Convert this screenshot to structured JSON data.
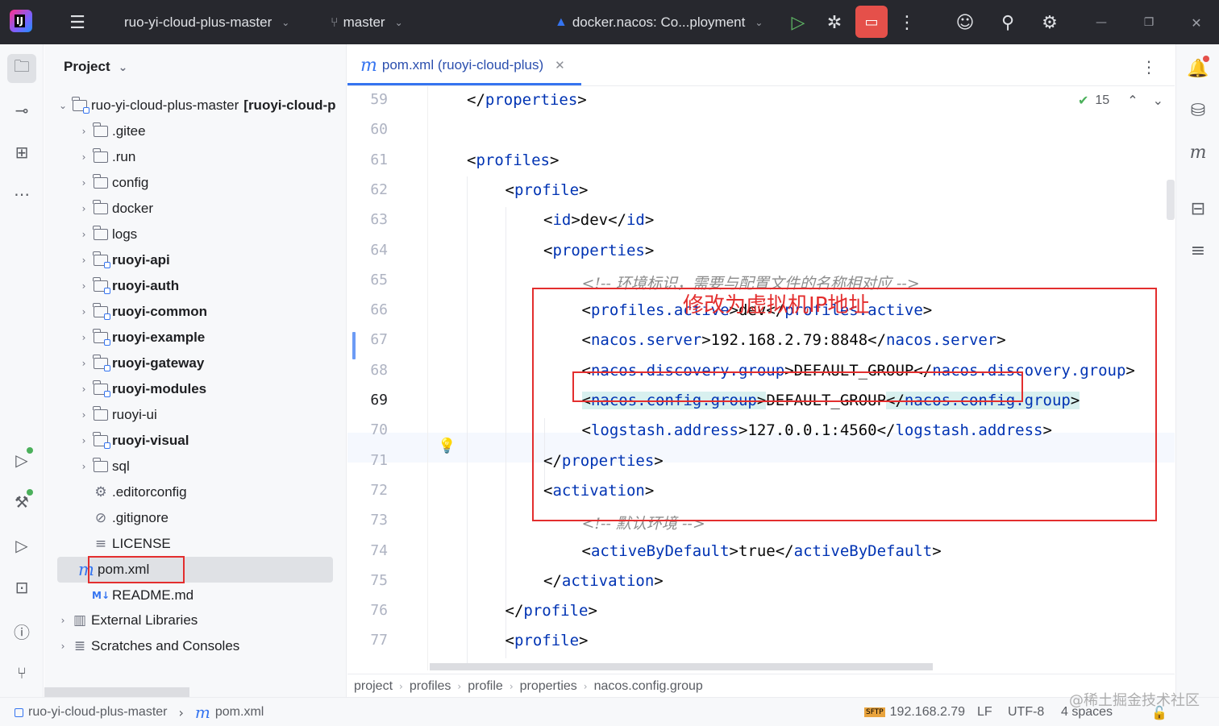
{
  "titlebar": {
    "project": "ruo-yi-cloud-plus-master",
    "branch": "master",
    "run_config": "docker.nacos: Co...ployment"
  },
  "project_panel": {
    "title": "Project",
    "root": {
      "name": "ruo-yi-cloud-plus-master",
      "qualifier": "[ruoyi-cloud-p"
    },
    "items": [
      {
        "label": ".gitee",
        "kind": "folder"
      },
      {
        "label": ".run",
        "kind": "folder"
      },
      {
        "label": "config",
        "kind": "folder"
      },
      {
        "label": "docker",
        "kind": "folder"
      },
      {
        "label": "logs",
        "kind": "folder"
      },
      {
        "label": "ruoyi-api",
        "kind": "module"
      },
      {
        "label": "ruoyi-auth",
        "kind": "module"
      },
      {
        "label": "ruoyi-common",
        "kind": "module"
      },
      {
        "label": "ruoyi-example",
        "kind": "module"
      },
      {
        "label": "ruoyi-gateway",
        "kind": "module"
      },
      {
        "label": "ruoyi-modules",
        "kind": "module"
      },
      {
        "label": "ruoyi-ui",
        "kind": "folder-plain"
      },
      {
        "label": "ruoyi-visual",
        "kind": "module"
      },
      {
        "label": "sql",
        "kind": "folder"
      },
      {
        "label": ".editorconfig",
        "kind": "file"
      },
      {
        "label": ".gitignore",
        "kind": "file"
      },
      {
        "label": "LICENSE",
        "kind": "file"
      },
      {
        "label": "pom.xml",
        "kind": "maven"
      },
      {
        "label": "README.md",
        "kind": "markdown"
      }
    ],
    "external_libraries": "External Libraries",
    "scratches": "Scratches and Consoles"
  },
  "editor": {
    "tab_label": "pom.xml (ruoyi-cloud-plus)",
    "inspection_count": "15",
    "annotation": "修改为虚拟机IP地址",
    "lines": [
      {
        "num": "59",
        "text": "</properties>"
      },
      {
        "num": "60",
        "text": ""
      },
      {
        "num": "61",
        "text": "<profiles>"
      },
      {
        "num": "62",
        "text": "<profile>"
      },
      {
        "num": "63",
        "text": "<id>dev</id>"
      },
      {
        "num": "64",
        "text": "<properties>"
      },
      {
        "num": "65",
        "text": "<!-- 环境标识，需要与配置文件的名称相对应 -->"
      },
      {
        "num": "66",
        "text": "<profiles.active>dev</profiles.active>"
      },
      {
        "num": "67",
        "text": "<nacos.server>192.168.2.79:8848</nacos.server>"
      },
      {
        "num": "68",
        "text": "<nacos.discovery.group>DEFAULT_GROUP</nacos.discovery.group>"
      },
      {
        "num": "69",
        "text": "<nacos.config.group>DEFAULT_GROUP</nacos.config.group>"
      },
      {
        "num": "70",
        "text": "<logstash.address>127.0.0.1:4560</logstash.address>"
      },
      {
        "num": "71",
        "text": "</properties>"
      },
      {
        "num": "72",
        "text": "<activation>"
      },
      {
        "num": "73",
        "text": "<!-- 默认环境 -->"
      },
      {
        "num": "74",
        "text": "<activeByDefault>true</activeByDefault>"
      },
      {
        "num": "75",
        "text": "</activation>"
      },
      {
        "num": "76",
        "text": "</profile>"
      },
      {
        "num": "77",
        "text": "<profile>"
      }
    ]
  },
  "breadcrumbs": [
    "project",
    "profiles",
    "profile",
    "properties",
    "nacos.config.group"
  ],
  "statusbar": {
    "project": "ruo-yi-cloud-plus-master",
    "file": "pom.xml",
    "sftp_host": "192.168.2.79",
    "line_sep": "LF",
    "encoding": "UTF-8",
    "indent": "4 spaces"
  },
  "watermark": "@稀土掘金技术社区",
  "colors": {
    "tag": "#0033b3",
    "comment": "#8c8c8c",
    "annotation_red": "#e32e2e",
    "accent": "#3574f0",
    "titlebar_bg": "#27282e"
  }
}
